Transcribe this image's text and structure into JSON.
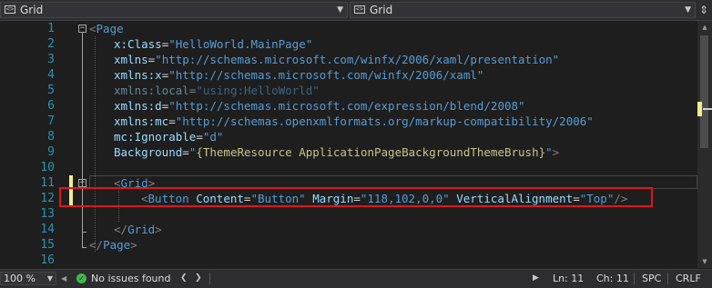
{
  "navbar": {
    "left_combo": {
      "icon": "xaml-element-icon",
      "label": "Grid"
    },
    "right_combo": {
      "icon": "xaml-element-icon",
      "label": "Grid"
    }
  },
  "editor": {
    "lines": [
      {
        "num": "1"
      },
      {
        "num": "2"
      },
      {
        "num": "3"
      },
      {
        "num": "4"
      },
      {
        "num": "5"
      },
      {
        "num": "6"
      },
      {
        "num": "7"
      },
      {
        "num": "8"
      },
      {
        "num": "9"
      },
      {
        "num": "10"
      },
      {
        "num": "11"
      },
      {
        "num": "12"
      },
      {
        "num": "13"
      },
      {
        "num": "14"
      },
      {
        "num": "15"
      },
      {
        "num": "16"
      }
    ],
    "code": {
      "l1": {
        "open": "<",
        "tag": "Page"
      },
      "l2": {
        "attr": "x:Class",
        "eq": "=",
        "val": "\"HelloWorld.MainPage\""
      },
      "l3": {
        "attr": "xmlns",
        "eq": "=",
        "val": "\"http://schemas.microsoft.com/winfx/2006/xaml/presentation\""
      },
      "l4": {
        "attr": "xmlns:x",
        "eq": "=",
        "val": "\"http://schemas.microsoft.com/winfx/2006/xaml\""
      },
      "l5": {
        "attr": "xmlns:local",
        "eq": "=",
        "val": "\"using:HelloWorld\""
      },
      "l6": {
        "attr": "xmlns:d",
        "eq": "=",
        "val": "\"http://schemas.microsoft.com/expression/blend/2008\""
      },
      "l7": {
        "attr": "xmlns:mc",
        "eq": "=",
        "val": "\"http://schemas.openxmlformats.org/markup-compatibility/2006\""
      },
      "l8": {
        "attr": "mc:Ignorable",
        "eq": "=",
        "val": "\"d\""
      },
      "l9": {
        "attr": "Background",
        "eq": "=",
        "q1": "\"",
        "ext": "{ThemeResource ApplicationPageBackgroundThemeBrush}",
        "q2": "\"",
        "close": ">"
      },
      "l11": {
        "open": "<",
        "tag": "Grid",
        "close": ">"
      },
      "l12": {
        "open": "<",
        "tag": "Button",
        "a1": "Content",
        "v1": "\"Button\"",
        "a2": "Margin",
        "v2": "\"118,102,0,0\"",
        "a3": "VerticalAlignment",
        "v3": "\"Top\"",
        "close": "/>"
      },
      "l14": {
        "open": "</",
        "tag": "Grid",
        "close": ">"
      },
      "l15": {
        "open": "</",
        "tag": "Page",
        "close": ">"
      }
    }
  },
  "status": {
    "zoom": "100 %",
    "issues_icon": "check-circle-icon",
    "issues": "No issues found",
    "line": "Ln: 11",
    "col": "Ch: 11",
    "whitespace": "SPC",
    "line_ending": "CRLF"
  },
  "colors": {
    "highlight": "#e0161d",
    "change_marker": "#efef8b",
    "line_number": "#2b91af"
  }
}
